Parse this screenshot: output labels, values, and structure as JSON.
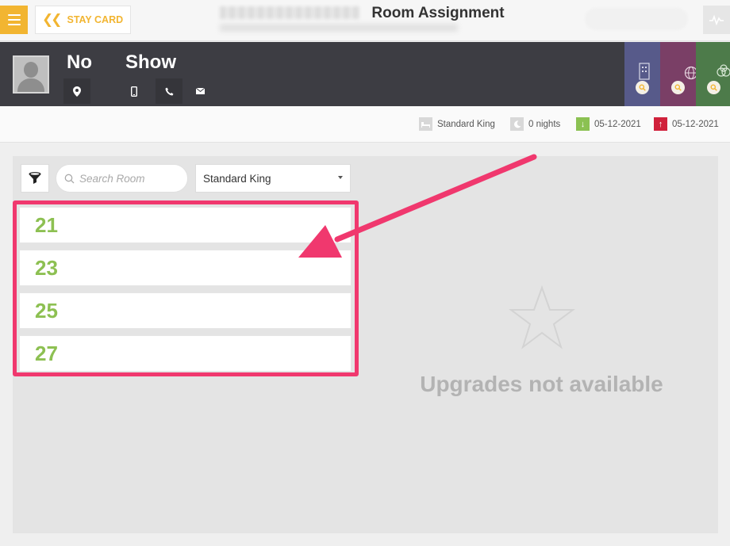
{
  "topbar": {
    "menu_icon": "hamburger-menu-icon",
    "back_label": "STAY CARD",
    "back_icon": "double-chevron-left-icon",
    "title": "Room Assignment",
    "activity_icon": "activity-pulse-icon"
  },
  "guest": {
    "first_name": "No",
    "last_name": "Show",
    "icons": [
      "location-pin-icon",
      "mobile-phone-icon",
      "phone-icon",
      "email-icon"
    ],
    "side_tabs": [
      {
        "name": "building-icon",
        "color": "#575a8a"
      },
      {
        "name": "globe-icon",
        "color": "#7a3f66"
      },
      {
        "name": "circles-icon",
        "color": "#4d7b4a"
      }
    ]
  },
  "stay_info": {
    "room_type": "Standard King",
    "nights": "0 nights",
    "arrival": "05-12-2021",
    "departure": "05-12-2021",
    "arrival_color": "#8bc152",
    "departure_color": "#d0213b"
  },
  "filters": {
    "filter_icon": "funnel-filter-icon",
    "search_placeholder": "Search Room",
    "room_type_selected": "Standard King"
  },
  "rooms": [
    "21",
    "23",
    "25",
    "27"
  ],
  "upgrades": {
    "icon": "star-outline-icon",
    "message": "Upgrades not available"
  },
  "colors": {
    "accent": "#f2b531",
    "room_number": "#8dc052",
    "annotation": "#f0386e",
    "header_bg": "#3d3d43"
  }
}
